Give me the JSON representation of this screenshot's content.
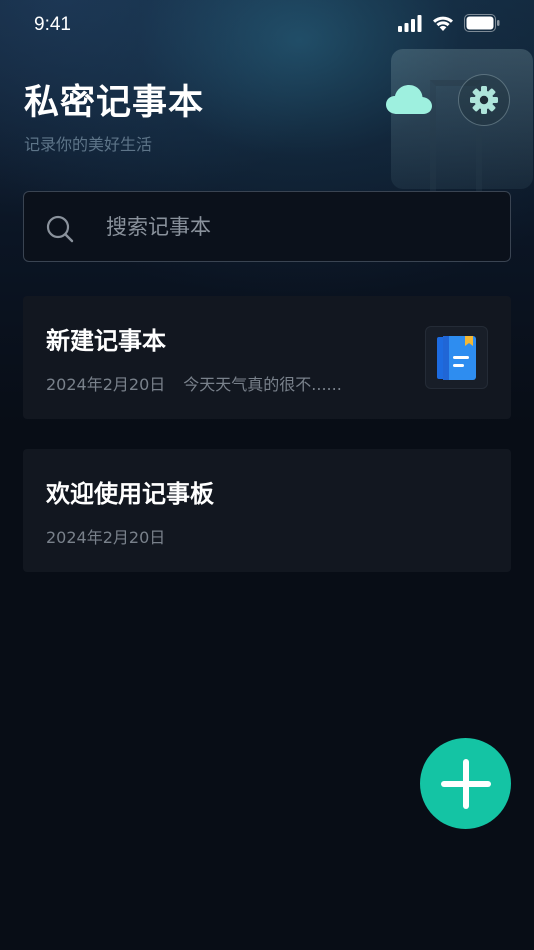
{
  "status_bar": {
    "time": "9:41",
    "icons": [
      "signal-icon",
      "wifi-icon",
      "battery-icon"
    ]
  },
  "header": {
    "title": "私密记事本",
    "subtitle": "记录你的美好生活",
    "cloud_icon": "cloud-icon",
    "settings_icon": "gear-icon"
  },
  "search": {
    "placeholder": "搜索记事本",
    "value": ""
  },
  "notes": [
    {
      "title": "新建记事本",
      "date": "2024年2月20日",
      "preview": "今天天气真的很不......",
      "thumbnail_icon": "notebook-icon"
    },
    {
      "title": "欢迎使用记事板",
      "date": "2024年2月20日"
    }
  ],
  "fab": {
    "icon": "plus-icon"
  },
  "colors": {
    "background": "#080d16",
    "card": "#121720",
    "accent": "#14c4a4",
    "cloud": "#9ef0df",
    "subtitle": "#5d7488",
    "meta_text": "#79818b"
  }
}
